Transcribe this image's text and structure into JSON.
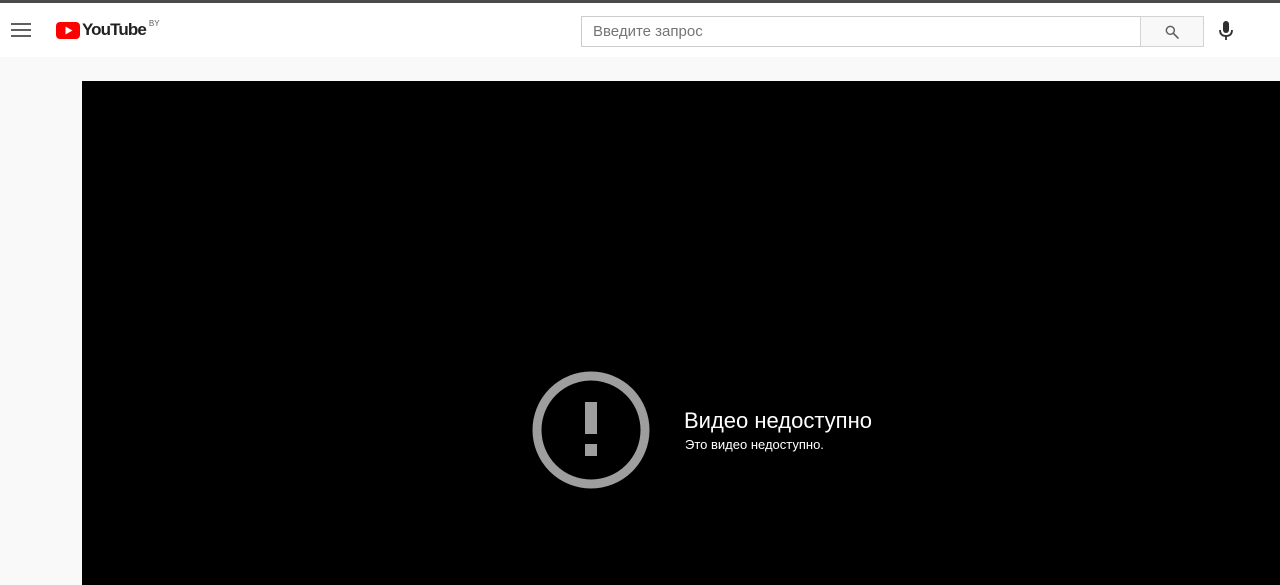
{
  "masthead": {
    "menu_icon": "hamburger-menu-icon",
    "logo": {
      "text": "YouTube",
      "country_code": "BY",
      "brand_color": "#ff0000"
    },
    "search": {
      "placeholder": "Введите запрос",
      "value": "",
      "button_icon": "search-icon"
    },
    "voice_search_icon": "microphone-icon"
  },
  "player": {
    "background": "#000000",
    "error": {
      "icon": "exclamation-circle-icon",
      "icon_color": "#9e9e9e",
      "title": "Видео недоступно",
      "subtitle": "Это видео недоступно."
    }
  }
}
